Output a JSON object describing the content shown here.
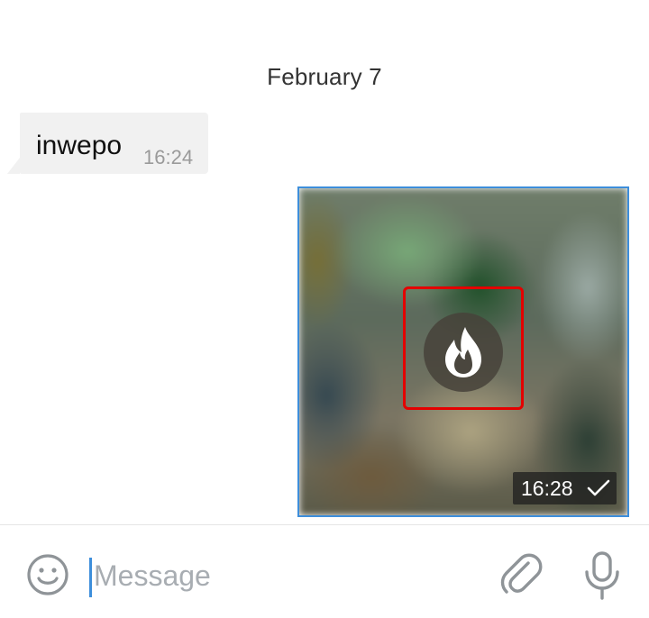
{
  "chat": {
    "date_header": "February 7",
    "messages": [
      {
        "direction": "incoming",
        "text": "inwepo",
        "time": "16:24"
      },
      {
        "direction": "outgoing",
        "type": "self-destruct-media",
        "icon": "fire-icon",
        "time": "16:28",
        "status_icon": "check-icon"
      }
    ]
  },
  "input_bar": {
    "placeholder": "Message",
    "value": "",
    "emoji_icon": "emoji-smile-icon",
    "attach_icon": "paperclip-icon",
    "mic_icon": "microphone-icon"
  },
  "colors": {
    "accent": "#3d8edb",
    "highlight": "#e40000",
    "incoming_bubble": "#f1f1f1",
    "time_gray": "#9a9a9a",
    "icon_gray": "#8f9498"
  }
}
